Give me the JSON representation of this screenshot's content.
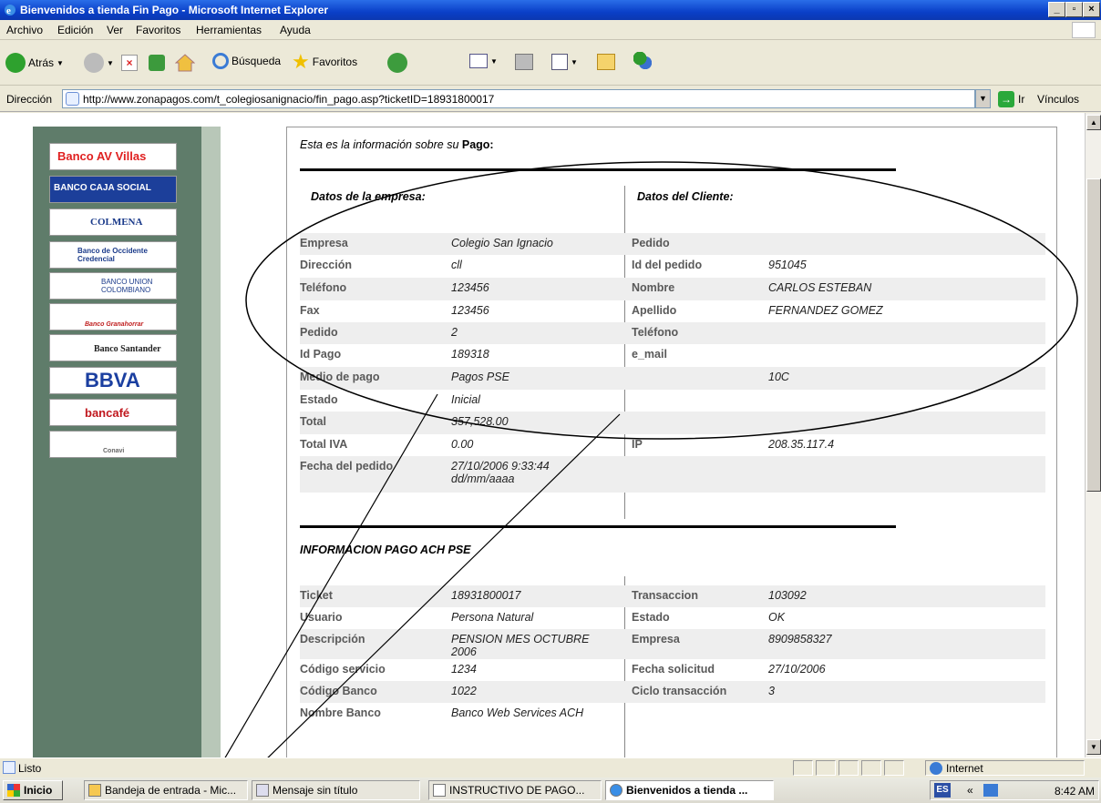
{
  "window": {
    "title": "Bienvenidos a tienda Fin Pago - Microsoft Internet Explorer"
  },
  "menu": [
    "Archivo",
    "Edición",
    "Ver",
    "Favoritos",
    "Herramientas",
    "Ayuda"
  ],
  "toolbar": {
    "back": "Atrás",
    "search": "Búsqueda",
    "favorites": "Favoritos"
  },
  "address": {
    "label": "Dirección",
    "url": "http://www.zonapagos.com/t_colegiosanignacio/fin_pago.asp?ticketID=18931800017",
    "go": "Ir",
    "links": "Vínculos"
  },
  "banks": [
    "Banco AV Villas",
    "BANCO CAJA SOCIAL",
    "COLMENA",
    "Banco de Occidente Credencial",
    "BANCO UNION COLOMBIANO",
    "Banco Granahorrar",
    "Banco Santander",
    "BBVA",
    "bancafé",
    "Conavi"
  ],
  "page": {
    "intro": "Esta es la información sobre su",
    "intro_bold": "Pago:",
    "company_header": "Datos de la empresa:",
    "client_header": "Datos del Cliente:",
    "rows": [
      {
        "l1": "Empresa",
        "v1": "Colegio San Ignacio",
        "l2": "Pedido",
        "v2": ""
      },
      {
        "l1": "Dirección",
        "v1": "cll",
        "l2": "Id del pedido",
        "v2": "951045"
      },
      {
        "l1": "Teléfono",
        "v1": "123456",
        "l2": "Nombre",
        "v2": "CARLOS ESTEBAN"
      },
      {
        "l1": "Fax",
        "v1": "123456",
        "l2": "Apellido",
        "v2": "FERNANDEZ GOMEZ"
      },
      {
        "l1": "Pedido",
        "v1": "2",
        "l2": "Teléfono",
        "v2": ""
      },
      {
        "l1": "Id Pago",
        "v1": "189318",
        "l2": "e_mail",
        "v2": ""
      },
      {
        "l1": "Medio de pago",
        "v1": "Pagos PSE",
        "l2": "",
        "v2": "10C"
      },
      {
        "l1": "Estado",
        "v1": "Inicial",
        "l2": "",
        "v2": ""
      },
      {
        "l1": "Total",
        "v1": "357,528.00",
        "l2": "",
        "v2": ""
      },
      {
        "l1": "Total IVA",
        "v1": "0.00",
        "l2": "IP",
        "v2": "208.35.117.4"
      },
      {
        "l1": "Fecha del pedido",
        "v1": "27/10/2006 9:33:44",
        "v1b": "dd/mm/aaaa",
        "l2": "",
        "v2": ""
      }
    ],
    "ach_header": "INFORMACION PAGO ACH PSE",
    "ach_rows": [
      {
        "l1": "Ticket",
        "v1": "18931800017",
        "l2": "Transaccion",
        "v2": "103092"
      },
      {
        "l1": "Usuario",
        "v1": "Persona Natural",
        "l2": "Estado",
        "v2": "OK"
      },
      {
        "l1": "Descripción",
        "v1": "PENSION MES OCTUBRE",
        "v1b": "2006",
        "l2": "Empresa",
        "v2": "8909858327"
      },
      {
        "l1": "Código servicio",
        "v1": "1234",
        "l2": "Fecha solicitud",
        "v2": "27/10/2006"
      },
      {
        "l1": "Código Banco",
        "v1": "1022",
        "l2": "Ciclo transacción",
        "v2": "3"
      },
      {
        "l1": "Nombre Banco",
        "v1": "Banco Web Services ACH",
        "l2": "",
        "v2": ""
      }
    ]
  },
  "status": {
    "text": "Listo",
    "zone": "Internet"
  },
  "taskbar": {
    "start": "Inicio",
    "items": [
      "Bandeja de entrada - Mic...",
      "Mensaje sin título",
      "INSTRUCTIVO DE PAGO...",
      "Bienvenidos a tienda ..."
    ],
    "lang": "ES",
    "clock": "8:42 AM"
  },
  "colors": {
    "title_bar": "#0a3fc8",
    "left_panel": "#5f7c6a",
    "label_text": "#595959"
  }
}
